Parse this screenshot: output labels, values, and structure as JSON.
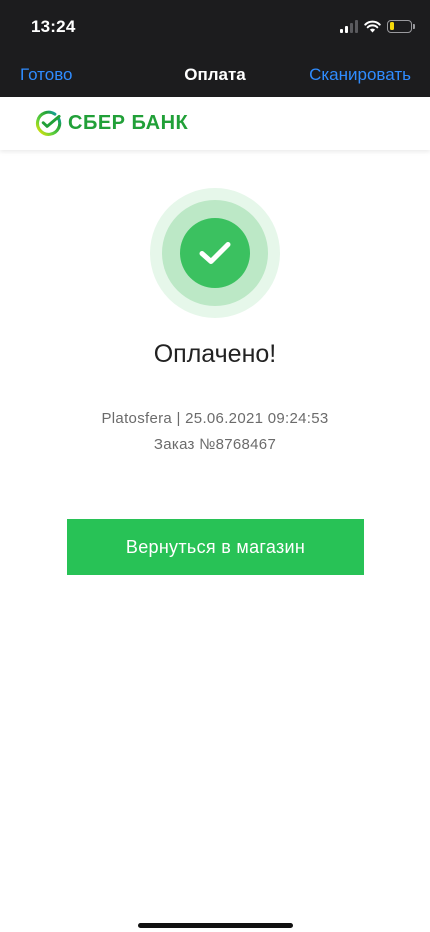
{
  "status_bar": {
    "time": "13:24",
    "icons": [
      "cellular-signal-icon",
      "wifi-icon",
      "battery-low-icon"
    ],
    "battery_level": 0.2
  },
  "nav_bar": {
    "done_label": "Готово",
    "title": "Оплата",
    "scan_label": "Сканировать"
  },
  "brand": {
    "name": "СБЕР БАНК",
    "color": "#21a038",
    "icon": "sber-logo-icon"
  },
  "payment": {
    "status_icon": "checkmark-icon",
    "status_text": "Оплачено!",
    "merchant_line": "Platosfera | 25.06.2021 09:24:53",
    "order_line": "Заказ №8768467",
    "return_button_label": "Вернуться в магазин"
  },
  "colors": {
    "nav_background": "#1c1c1e",
    "link_blue": "#2f8cff",
    "success_green": "#3bc160",
    "button_green": "#28c256"
  }
}
